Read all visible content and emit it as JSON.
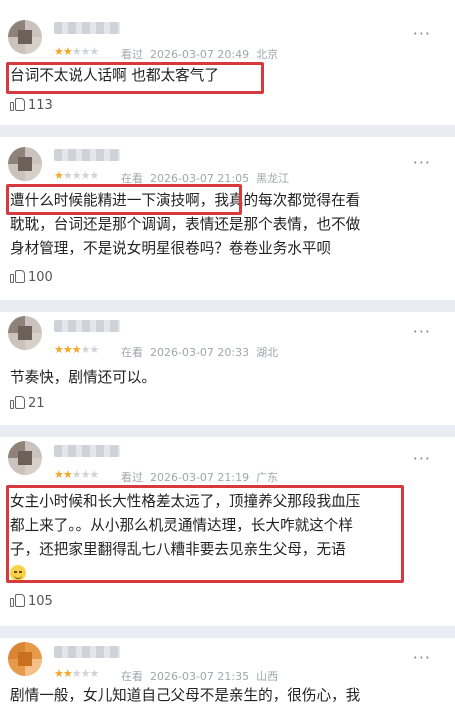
{
  "comments": [
    {
      "stars_on": "★★",
      "stars_off": "★★★",
      "status": "看过",
      "time": "2026-03-07 20:49",
      "location": "北京",
      "text": "台词不太说人话啊 也都太客气了",
      "likes": "113",
      "more": "···"
    },
    {
      "stars_on": "★",
      "stars_off": "★★★★",
      "status": "在看",
      "time": "2026-03-07 21:05",
      "location": "黑龙江",
      "text_line1": "遭什么时候能精进一下演技啊，我真的每次都觉得在看",
      "text_line2": "耽耽，台词还是那个调调，表情还是那个表情，也不做",
      "text_line3": "身材管理，不是说女明星很卷吗？卷卷业务水平呗",
      "likes": "100",
      "more": "···"
    },
    {
      "stars_on": "★★★",
      "stars_off": "★★",
      "status": "在看",
      "time": "2026-03-07 20:33",
      "location": "湖北",
      "text": "节奏快，剧情还可以。",
      "likes": "21",
      "more": "···"
    },
    {
      "stars_on": "★★",
      "stars_off": "★★★",
      "status": "看过",
      "time": "2026-03-07 21:19",
      "location": "广东",
      "text_line1": "女主小时候和长大性格差太远了，顶撞养父那段我血压",
      "text_line2": "都上来了。。从小那么机灵通情达理，长大咋就这个样",
      "text_line3": "子，还把家里翻得乱七八糟非要去见亲生父母，无语",
      "likes": "105",
      "more": "···"
    },
    {
      "stars_on": "★★",
      "stars_off": "★★★",
      "status": "在看",
      "time": "2026-03-07 21:35",
      "location": "山西",
      "text": "剧情一般，女儿知道自己父母不是亲生的，很伤心，我",
      "more": "···"
    }
  ],
  "colors": {
    "highlight": "#d63a3f",
    "star": "#f4a52a"
  }
}
